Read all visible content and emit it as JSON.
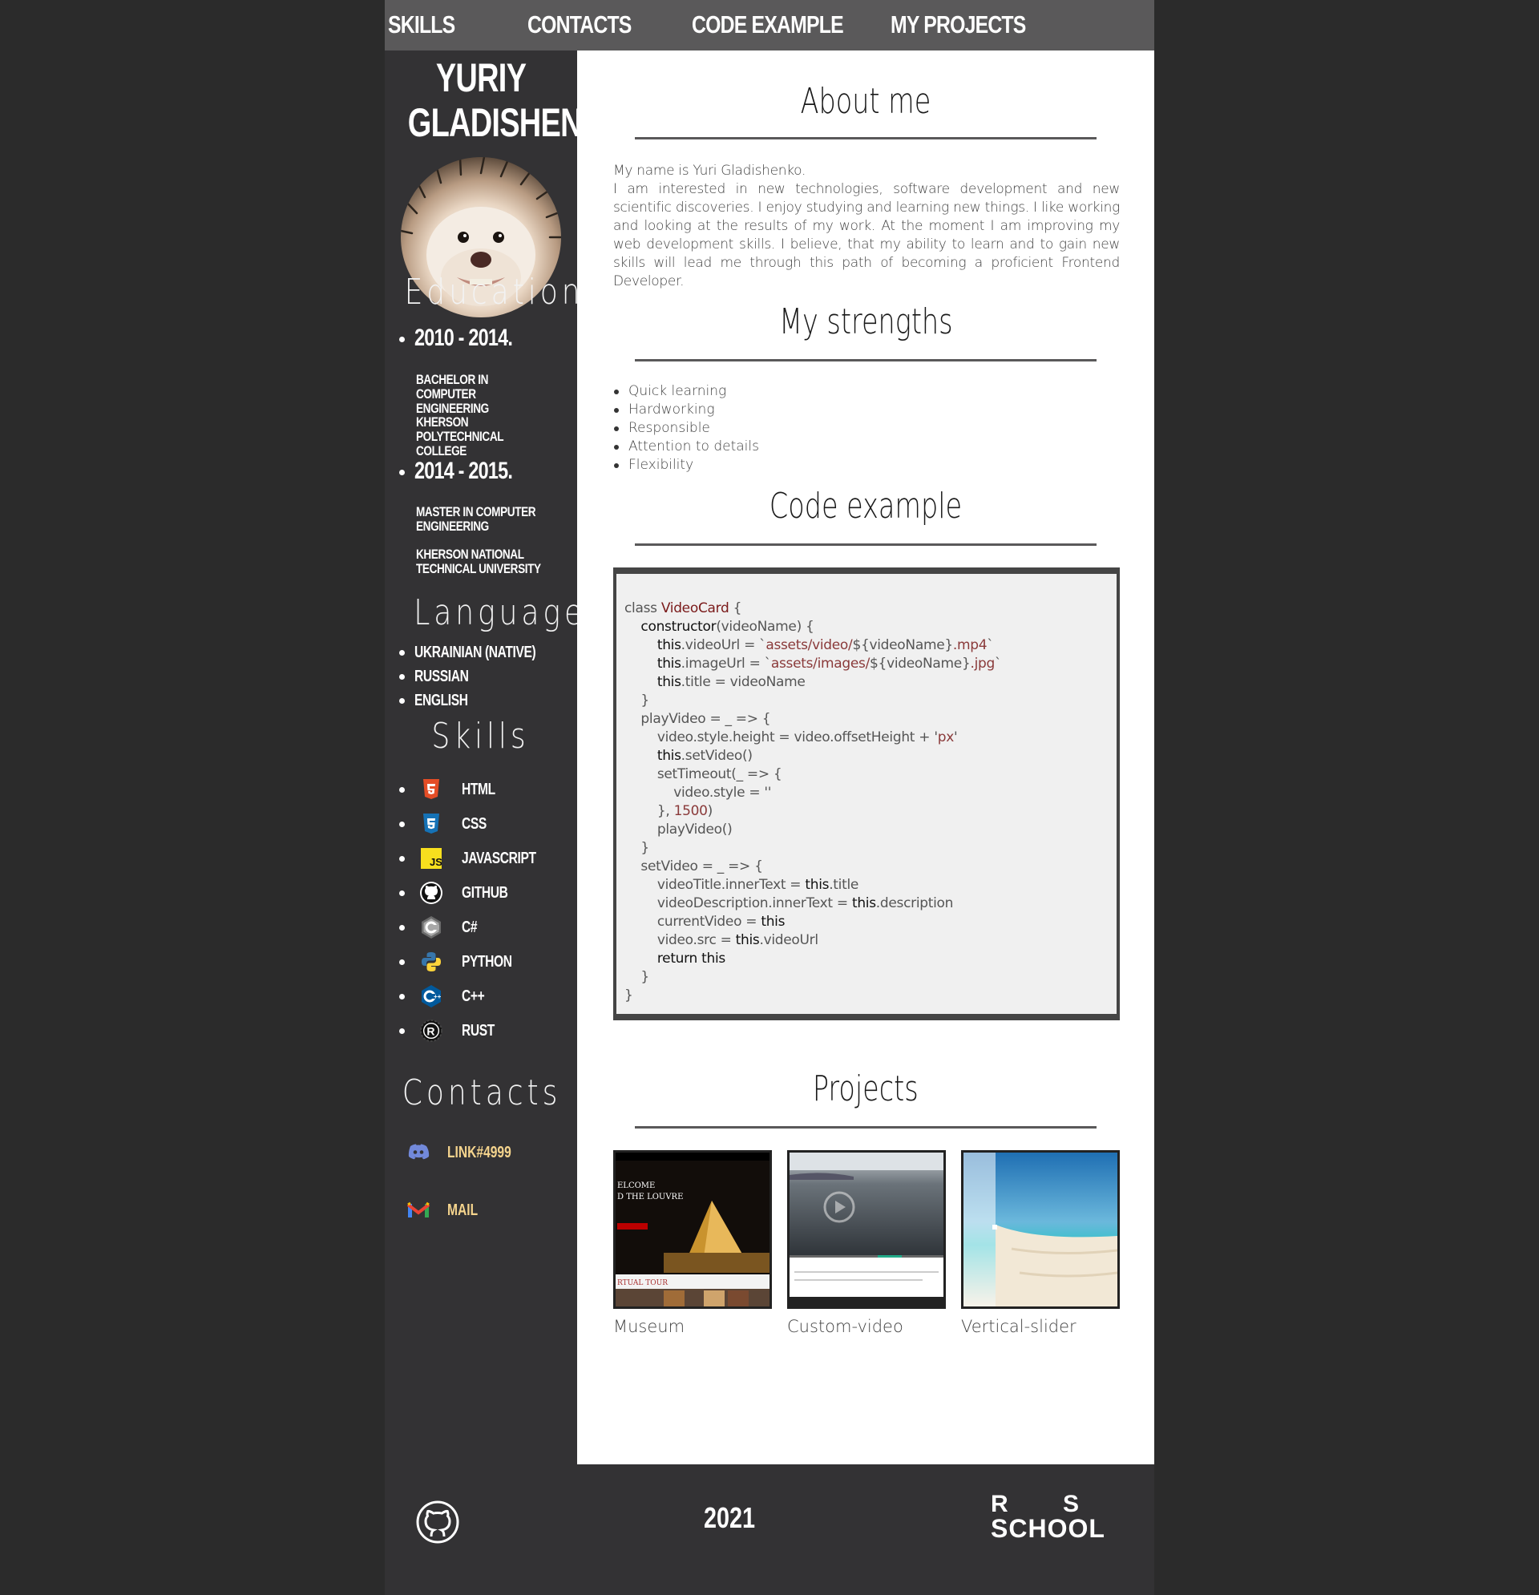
{
  "nav": {
    "items": [
      "SKILLS",
      "CONTACTS",
      "CODE EXAMPLE",
      "MY PROJECTS"
    ]
  },
  "profile": {
    "first_name": "YURIY",
    "last_name": "GLADISHENKO"
  },
  "education": {
    "title": "Education",
    "entries": [
      {
        "years": "2010 - 2014.",
        "degree": "Bachelor in Computer Engineering",
        "school": "Kherson Polytechnical College"
      },
      {
        "years": "2014 - 2015.",
        "degree": "Master in Computer Engineering",
        "school": "Kherson National Technical University"
      }
    ]
  },
  "languages": {
    "title": "Languages",
    "items": [
      "Ukrainian (native)",
      "Russian",
      "English"
    ]
  },
  "skills": {
    "title": "Skills",
    "items": [
      {
        "label": "HTML",
        "icon": "html5-icon"
      },
      {
        "label": "CSS",
        "icon": "css3-icon"
      },
      {
        "label": "JavaScript",
        "icon": "javascript-icon"
      },
      {
        "label": "GitHub",
        "icon": "github-icon"
      },
      {
        "label": "C#",
        "icon": "csharp-icon"
      },
      {
        "label": "Python",
        "icon": "python-icon"
      },
      {
        "label": "C++",
        "icon": "cplusplus-icon"
      },
      {
        "label": "Rust",
        "icon": "rust-icon"
      }
    ]
  },
  "contacts": {
    "title": "Contacts",
    "discord": "LINK#4999",
    "mail": "MAIL"
  },
  "about": {
    "title": "About me",
    "line1": "My name is Yuri Gladishenko.",
    "text": "I am interested in new technologies, software development and new scientific discoveries. I enjoy studying and learning new things. I like working and looking at the results of my work. At the moment I am improving my web development skills. I believe, that my ability to learn and to gain new skills will lead me through this path of becoming a proficient Frontend Developer."
  },
  "strengths": {
    "title": "My strengths",
    "items": [
      "Quick learning",
      "Hardworking",
      "Responsible",
      "Attention to details",
      "Flexibility"
    ]
  },
  "code_example": {
    "title": "Code example"
  },
  "projects": {
    "title": "Projects",
    "items": [
      {
        "name": "Museum",
        "thumb_text_1": "ELCOME",
        "thumb_text_2": "D THE LOUVRE",
        "thumb_text_3": "RTUAL TOUR"
      },
      {
        "name": "Custom-video"
      },
      {
        "name": "Vertical-slider"
      }
    ]
  },
  "footer": {
    "year": "2021",
    "school_top": "R S",
    "school_bottom": "SCHOOL"
  },
  "colors": {
    "background": "#2b2b2b",
    "sidebar": "#333234",
    "nav": "#5a595a",
    "accent": "#f5d48d"
  }
}
